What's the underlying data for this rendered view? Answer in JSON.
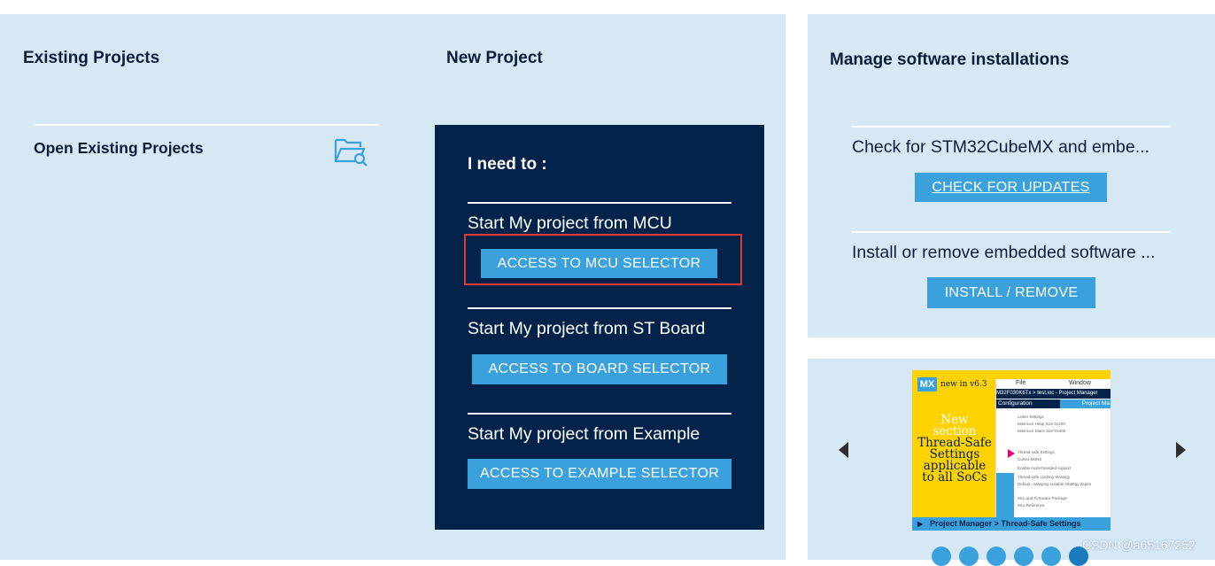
{
  "existing": {
    "title": "Existing Projects",
    "open_label": "Open Existing Projects",
    "open_icon": "folder-search-icon"
  },
  "new_project": {
    "title": "New Project",
    "need_title": "I need to :",
    "sections": [
      {
        "label": "Start My project from MCU",
        "button": "ACCESS TO MCU SELECTOR"
      },
      {
        "label": "Start My project from ST Board",
        "button": "ACCESS TO BOARD SELECTOR"
      },
      {
        "label": "Start My project from Example",
        "button": "ACCESS TO EXAMPLE SELECTOR"
      }
    ]
  },
  "manage": {
    "title": "Manage software installations",
    "check_text": "Check for STM32CubeMX and embe...",
    "check_button": "CHECK FOR UPDATES",
    "install_text": "Install or remove embedded software ...",
    "install_button": "INSTALL / REMOVE"
  },
  "news": {
    "badge": "MX",
    "version": "new in v6.3",
    "line1": "New",
    "line2": "section",
    "line3": "Thread-Safe",
    "line4": "Settings",
    "line5": "applicable",
    "line6": "to all SoCs",
    "menu_file": "File",
    "menu_window": "Window",
    "path": "M32F030K6Tx > test.ioc - Project Manager",
    "tab_config": "Configuration",
    "tab_pm": "Project Ma",
    "footer": "Project Manager > Thread-Safe Settings",
    "shot_lines": [
      "Linker Settings",
      "Minimum Heap Size  0x200",
      "Minimum Stack Size  0x400",
      "Thread-safe Settings",
      "Cortex-M0NS",
      "Enable multi-threaded support",
      "Thread-safe Locking Strategy",
      "Default - Mapping suitable strategy depen",
      "Mcu and Firmware Package",
      "Mcu Reference"
    ]
  },
  "carousel": {
    "dot_count": 6,
    "active_index": 5
  },
  "watermark": "CSDN @a65167252",
  "colors": {
    "panel_bg": "#d7e8f5",
    "dark_navy": "#03234b",
    "button_blue": "#3ba1dc",
    "highlight_red": "#e03c31",
    "news_yellow": "#ffd200"
  }
}
